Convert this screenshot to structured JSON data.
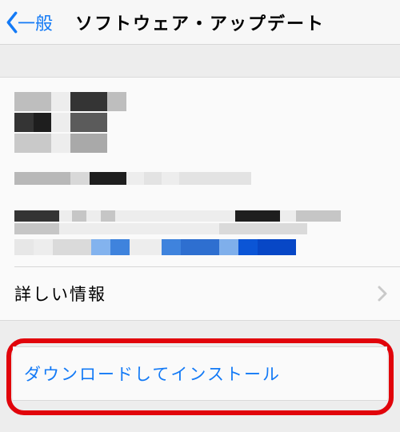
{
  "nav": {
    "back_label": "一般",
    "title": "ソフトウェア・アップデート"
  },
  "more_info_label": "詳しい情報",
  "download_install_label": "ダウンロードしてインストール",
  "colors": {
    "link": "#137AF6",
    "highlight_border": "#E1040B"
  }
}
